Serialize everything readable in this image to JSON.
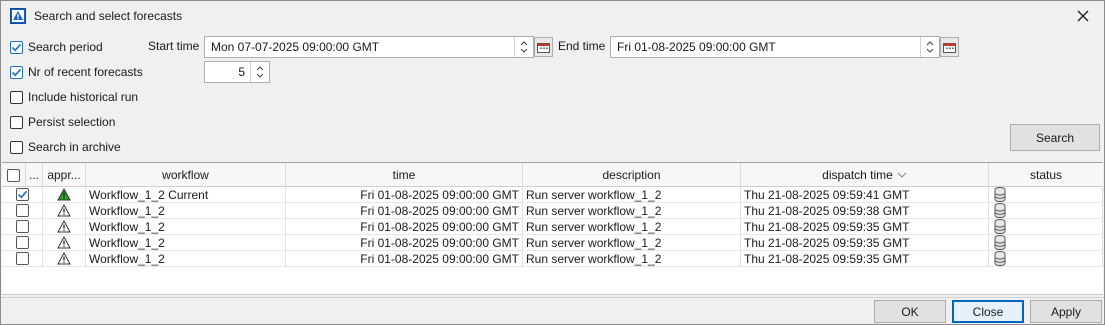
{
  "window": {
    "title": "Search and select forecasts"
  },
  "filters": {
    "search_period": {
      "label": "Search period",
      "checked": true
    },
    "nr_recent": {
      "label": "Nr of recent forecasts",
      "checked": true,
      "value": "5"
    },
    "include_historical": {
      "label": "Include historical run",
      "checked": false
    },
    "persist_selection": {
      "label": "Persist selection",
      "checked": false
    },
    "search_archive": {
      "label": "Search in archive",
      "checked": false
    },
    "start_time_label": "Start time",
    "start_time_value": "Mon 07-07-2025 09:00:00 GMT",
    "end_time_label": "End time",
    "end_time_value": "Fri 01-08-2025 09:00:00 GMT",
    "search_button": "Search"
  },
  "table": {
    "headers": {
      "select": "...",
      "approved": "appr...",
      "workflow": "workflow",
      "time": "time",
      "description": "description",
      "dispatch_time": "dispatch time",
      "status": "status"
    },
    "rows": [
      {
        "checked": true,
        "approved_color": "#2f9e2f",
        "workflow": "Workflow_1_2 Current",
        "time": "Fri 01-08-2025 09:00:00 GMT",
        "description": "Run server workflow_1_2",
        "dispatch_time": "Thu 21-08-2025 09:59:41 GMT",
        "status_icon": "database-icon"
      },
      {
        "checked": false,
        "approved_color": "#ffffff",
        "workflow": "Workflow_1_2",
        "time": "Fri 01-08-2025 09:00:00 GMT",
        "description": "Run server workflow_1_2",
        "dispatch_time": "Thu 21-08-2025 09:59:38 GMT",
        "status_icon": "database-icon"
      },
      {
        "checked": false,
        "approved_color": "#ffffff",
        "workflow": "Workflow_1_2",
        "time": "Fri 01-08-2025 09:00:00 GMT",
        "description": "Run server workflow_1_2",
        "dispatch_time": "Thu 21-08-2025 09:59:35 GMT",
        "status_icon": "database-icon"
      },
      {
        "checked": false,
        "approved_color": "#ffffff",
        "workflow": "Workflow_1_2",
        "time": "Fri 01-08-2025 09:00:00 GMT",
        "description": "Run server workflow_1_2",
        "dispatch_time": "Thu 21-08-2025 09:59:35 GMT",
        "status_icon": "database-icon"
      },
      {
        "checked": false,
        "approved_color": "#ffffff",
        "workflow": "Workflow_1_2",
        "time": "Fri 01-08-2025 09:00:00 GMT",
        "description": "Run server workflow_1_2",
        "dispatch_time": "Thu 21-08-2025 09:59:35 GMT",
        "status_icon": "database-icon"
      }
    ]
  },
  "footer": {
    "ok": "OK",
    "close": "Close",
    "apply": "Apply"
  },
  "colors": {
    "accent": "#0067c0",
    "checkbox_check": "#1f6fc4",
    "approved_green": "#2f9e2f"
  }
}
